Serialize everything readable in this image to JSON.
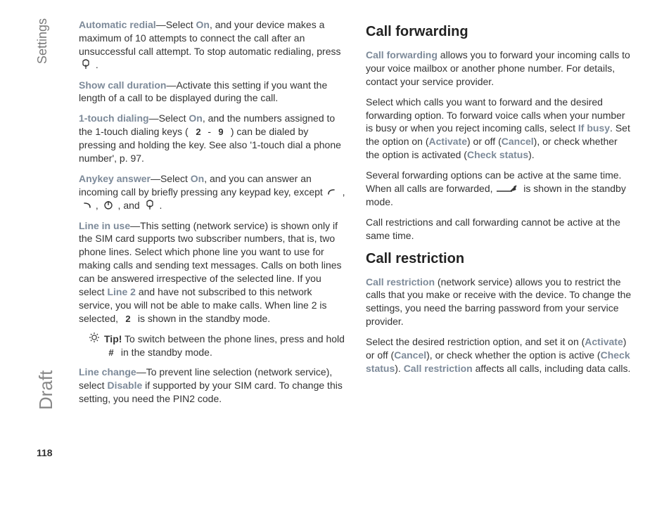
{
  "side_label": "Settings",
  "draft_label": "Draft",
  "page_number": "118",
  "left": {
    "auto_redial_term": "Automatic redial",
    "auto_redial_body_a": "—Select ",
    "on": "On",
    "auto_redial_body_b": ", and your device makes a maximum of 10 attempts to connect the call after an unsuccessful call attempt. To stop automatic redialing, press ",
    "show_dur_term": "Show call duration",
    "show_dur_body": "—Activate this setting if you want the length of a call to be displayed during the call.",
    "one_touch_term": "1-touch dialing",
    "one_touch_a": "—Select ",
    "one_touch_b": ", and the numbers assigned to the 1-touch dialing keys ( ",
    "one_touch_c": " - ",
    "one_touch_d": " ) can be dialed by pressing and holding the key. See also '1-touch dial a phone number', p. 97.",
    "anykey_term": "Anykey answer",
    "anykey_a": "—Select ",
    "anykey_b": ", and you can answer an incoming call by briefly pressing any keypad key, except ",
    "anykey_c": " , ",
    "anykey_d": " , ",
    "anykey_e": " , and ",
    "anykey_f": " .",
    "line_use_term": "Line in use",
    "line_use_a": "—This setting (network service) is shown only if the SIM card supports two subscriber numbers, that is, two phone lines. Select which phone line you want to use for making calls and sending text messages. Calls on both lines can be answered irrespective of the selected line. If you select ",
    "line2": "Line 2",
    "line_use_b": " and have not subscribed to this network service, you will not be able to make calls. When line 2 is selected, ",
    "line_use_c": " is shown in the standby mode.",
    "tip_label": "Tip!",
    "tip_body_a": " To switch between the phone lines, press and hold ",
    "tip_body_b": " in the standby mode.",
    "hash": "#",
    "line_change_term": "Line change",
    "line_change_a": "—To prevent line selection (network service), select ",
    "disable": "Disable",
    "line_change_b": " if supported by your SIM card. To change this setting, you need the PIN2 code."
  },
  "right": {
    "h_fwd": "Call forwarding",
    "fwd_term": "Call forwarding",
    "fwd_a": " allows you to forward your incoming calls to your voice mailbox or another phone number. For details, contact your service provider.",
    "fwd_b_a": "Select which calls you want to forward and the desired forwarding option. To forward voice calls when your number is busy or when you reject incoming calls, select ",
    "if_busy": "If busy",
    "fwd_b_b": ". Set the option on (",
    "activate": "Activate",
    "fwd_b_c": ") or off (",
    "cancel": "Cancel",
    "fwd_b_d": "), or check whether the option is activated (",
    "check_status": "Check status",
    "fwd_b_e": ").",
    "fwd_c_a": "Several forwarding options can be active at the same time. When all calls are forwarded, ",
    "fwd_c_b": " is shown in the standby mode.",
    "fwd_d": "Call restrictions and call forwarding cannot be active at the same time.",
    "h_restrict": "Call restriction",
    "restrict_term": "Call restriction",
    "restrict_a": " (network service) allows you to restrict the calls that you make or receive with the device. To change the settings, you need the barring password from your service provider.",
    "restrict_b_a": "Select the desired restriction option, and set it on (",
    "restrict_b_b": ") or off (",
    "restrict_b_c": "), or check whether the option is active (",
    "restrict_b_d": "). ",
    "restrict_b_e": " affects all calls, including data calls."
  }
}
